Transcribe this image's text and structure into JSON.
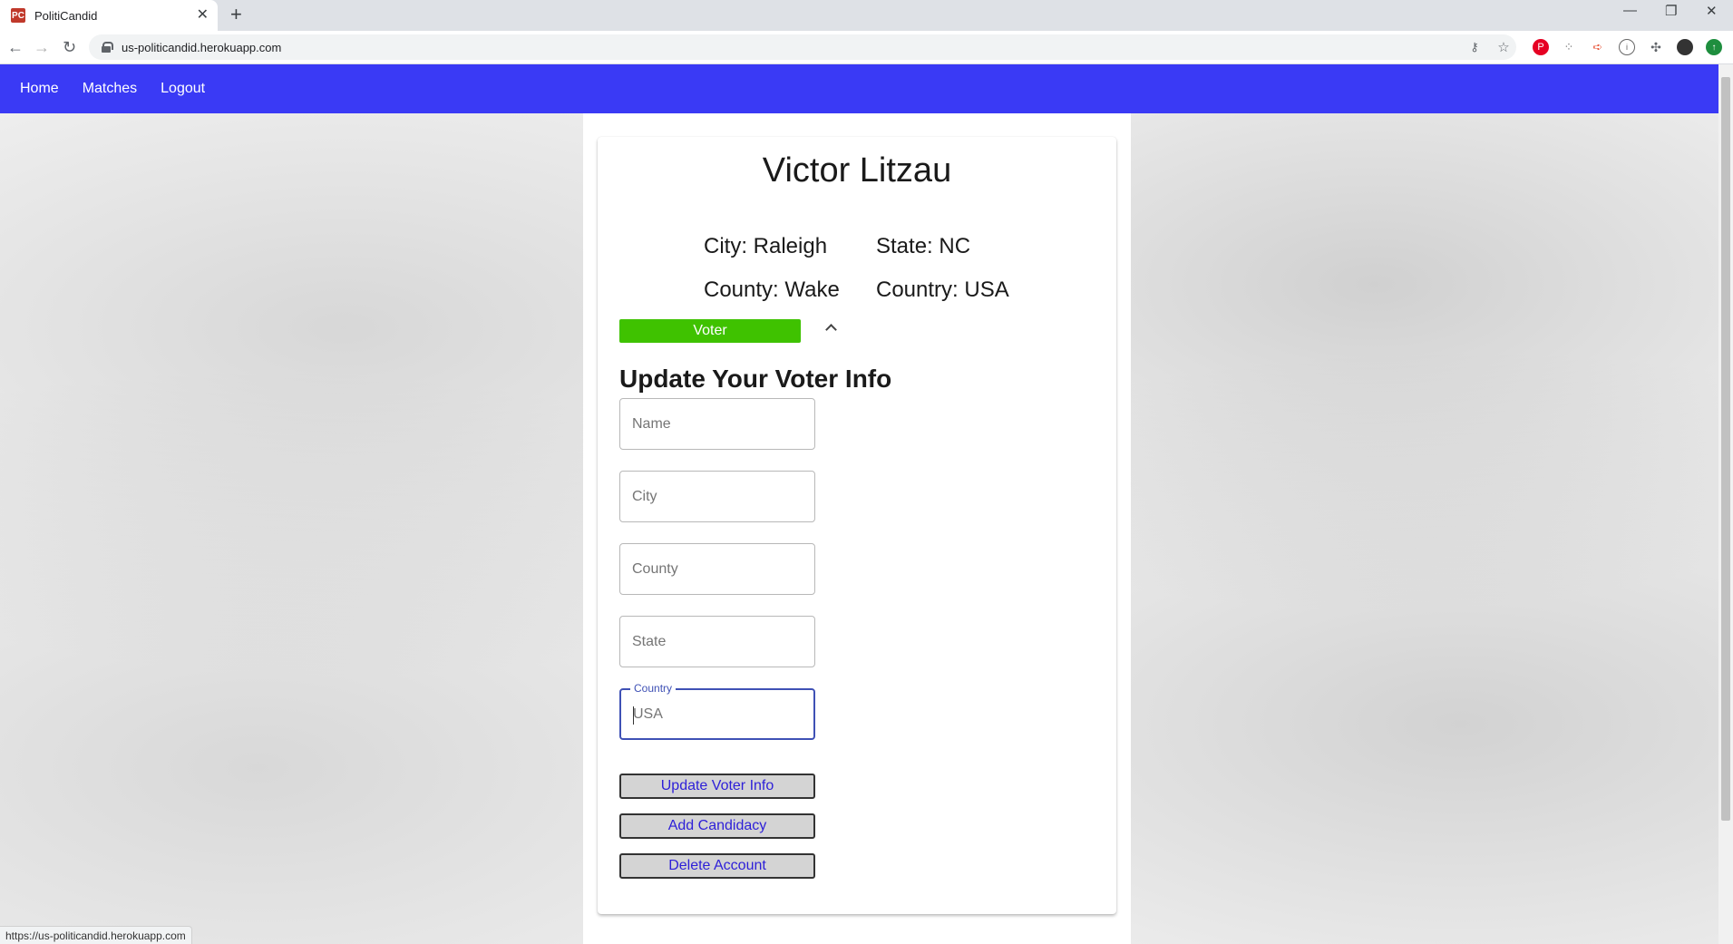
{
  "browser": {
    "tab_title": "PolitiCandid",
    "favicon_text": "PC",
    "url": "us-politicandid.herokuapp.com",
    "status_url": "https://us-politicandid.herokuapp.com"
  },
  "nav": {
    "home": "Home",
    "matches": "Matches",
    "logout": "Logout"
  },
  "profile": {
    "name": "Victor Litzau",
    "city": "City: Raleigh",
    "state": "State: NC",
    "county": "County: Wake",
    "country": "Country: USA",
    "role": "Voter"
  },
  "form": {
    "title": "Update Your Voter Info",
    "name_placeholder": "Name",
    "city_placeholder": "City",
    "county_placeholder": "County",
    "state_placeholder": "State",
    "country_label": "Country",
    "country_placeholder": "USA",
    "update_button": "Update Voter Info",
    "add_candidacy_button": "Add Candidacy",
    "delete_button": "Delete Account"
  },
  "colors": {
    "navbar": "#3a3af5",
    "role_badge": "#3fc200",
    "focus": "#3f51b5",
    "button_text": "#2d1fd8"
  }
}
